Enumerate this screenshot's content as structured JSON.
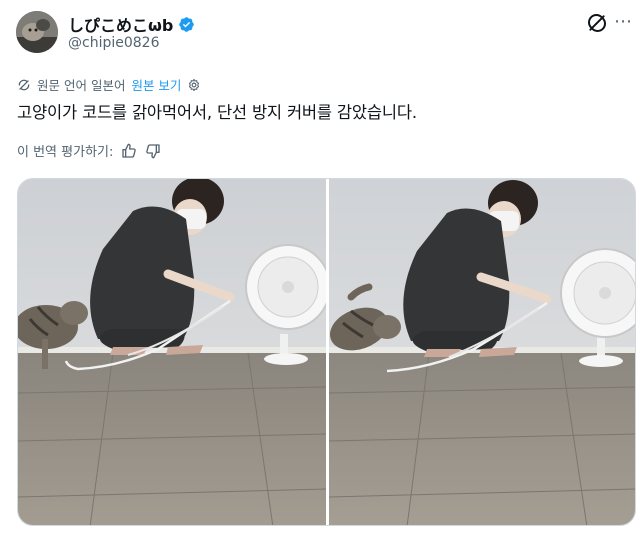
{
  "author": {
    "display_name": "しぴこめこωb",
    "handle": "@chipie0826",
    "verified": true,
    "badge_color": "#1d9bf0"
  },
  "header_icons": {
    "grok": "grok-icon",
    "more": "⋯"
  },
  "translation_bar": {
    "label": "원문 언어 일본어",
    "link": "원본 보기",
    "icon": "translate-icon",
    "settings_icon": "gear-icon"
  },
  "tweet": {
    "text": "고양이가 코드를 갉아먹어서, 단선 방지 커버를 감았습니다."
  },
  "rate_translation": {
    "label": "이 번역 평가하기:",
    "up_icon": "thumbs-up-icon",
    "down_icon": "thumbs-down-icon"
  },
  "media": {
    "photos": [
      "photo-1",
      "photo-2"
    ]
  },
  "colors": {
    "accent": "#1d9bf0",
    "muted": "#536471",
    "text": "#0f1419"
  }
}
